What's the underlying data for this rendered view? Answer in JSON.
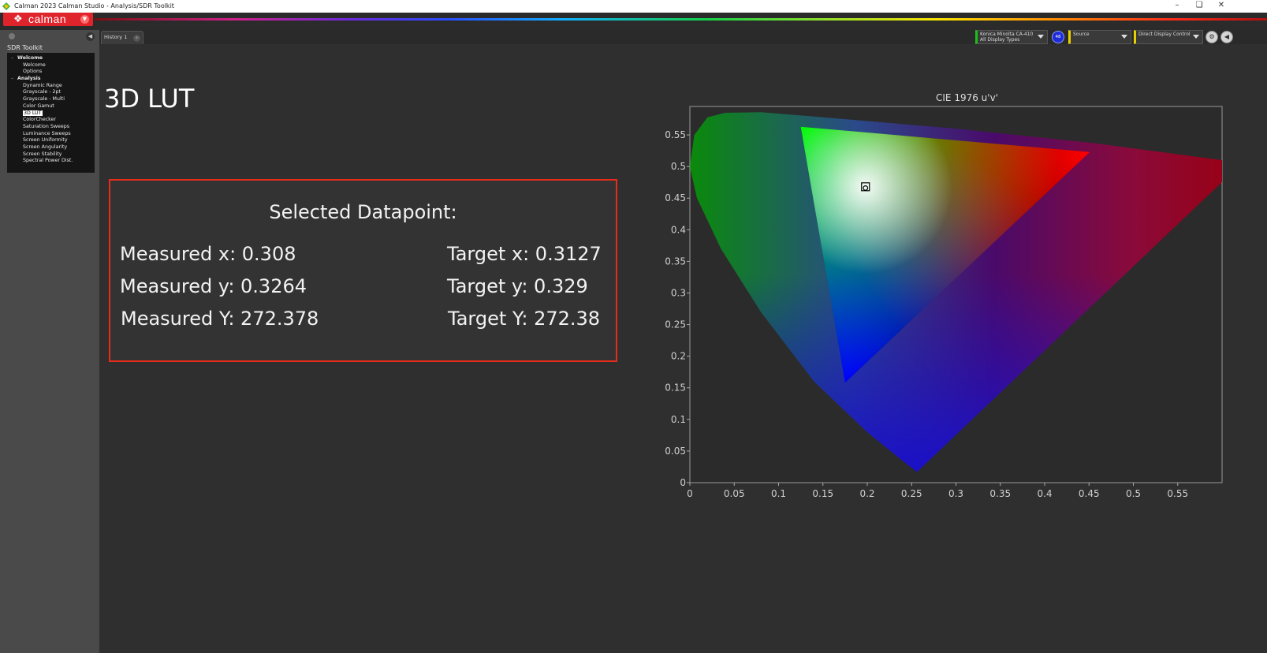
{
  "window": {
    "title": "Calman 2023 Calman Studio  - Analysis/SDR Toolkit",
    "minimize_icon": "minimize-icon",
    "restore_icon": "restore-icon",
    "close_icon": "close-icon"
  },
  "header": {
    "logo_text": "calman",
    "rainbow": "rainbow-gradient"
  },
  "left_panel": {
    "title": "SDR Toolkit",
    "groups": [
      {
        "label": "Welcome",
        "items": [
          "Welcome",
          "Options"
        ]
      },
      {
        "label": "Analysis",
        "items": [
          "Dynamic Range",
          "Grayscale - 2pt",
          "Grayscale - Multi",
          "Color Gamut",
          "3D LUT",
          "ColorChecker",
          "Saturation Sweeps",
          "Luminance Sweeps",
          "Screen Uniformity",
          "Screen Angularity",
          "Screen Stability",
          "Spectral Power Dist."
        ]
      }
    ],
    "selected_item": "3D LUT"
  },
  "tabs": [
    {
      "label": "History 1"
    }
  ],
  "devices": {
    "meter": {
      "line1": "Konica Minolta CA-410",
      "line2": "All Display Types",
      "accent": "#19c019"
    },
    "badge": "48",
    "source": {
      "line1": "Source",
      "accent": "#e8d000"
    },
    "display": {
      "line1": "Direct Display Control",
      "accent": "#e8d000"
    }
  },
  "main": {
    "title": "3D LUT",
    "selected": {
      "heading": "Selected Datapoint:",
      "measured_x": "Measured x: 0.308",
      "measured_y": "Measured y: 0.3264",
      "measured_Y": "Measured Y: 272.378",
      "target_x": "Target x: 0.3127",
      "target_y": "Target y: 0.329",
      "target_Y": "Target Y: 272.38",
      "border_color": "#e82c1b"
    }
  },
  "chart_data": {
    "type": "scatter",
    "title": "CIE 1976 u'v'",
    "xlabel": "",
    "ylabel": "",
    "xlim": [
      0,
      0.6
    ],
    "ylim": [
      0,
      0.6
    ],
    "x_ticks": [
      "0",
      "0.05",
      "0.1",
      "0.15",
      "0.2",
      "0.25",
      "0.3",
      "0.35",
      "0.4",
      "0.45",
      "0.5",
      "0.55"
    ],
    "y_ticks": [
      "0",
      "0.05",
      "0.1",
      "0.15",
      "0.2",
      "0.25",
      "0.3",
      "0.35",
      "0.4",
      "0.45",
      "0.5",
      "0.55"
    ],
    "grid": false,
    "gamut_triangle": [
      {
        "u": 0.451,
        "v": 0.523
      },
      {
        "u": 0.125,
        "v": 0.563
      },
      {
        "u": 0.175,
        "v": 0.158
      }
    ],
    "measured_point": {
      "u": 0.198,
      "v": 0.466
    },
    "target_point": {
      "u": 0.198,
      "v": 0.468
    }
  }
}
